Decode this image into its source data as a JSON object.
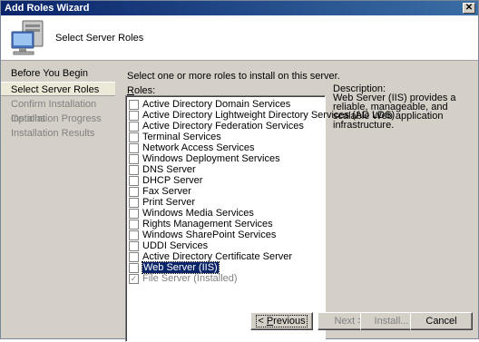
{
  "window": {
    "title": "Add Roles Wizard",
    "close_glyph": "✕"
  },
  "header": {
    "title": "Select Server Roles",
    "icon": "server-computer-icon"
  },
  "nav": {
    "items": [
      {
        "label": "Before You Begin",
        "state": "done"
      },
      {
        "label": "Select Server Roles",
        "state": "active"
      },
      {
        "label": "Confirm Installation Options",
        "state": "pending"
      },
      {
        "label": "Installation Progress",
        "state": "pending"
      },
      {
        "label": "Installation Results",
        "state": "pending"
      }
    ]
  },
  "content": {
    "instruction": "Select one or more roles to install on this server.",
    "roles_label_mnemonic": "R",
    "roles_label_rest": "oles:",
    "roles": [
      {
        "label": "Active Directory Domain Services",
        "checked": false
      },
      {
        "label": "Active Directory Lightweight Directory Services (AD LDS)",
        "checked": false
      },
      {
        "label": "Active Directory Federation Services",
        "checked": false
      },
      {
        "label": "Terminal Services",
        "checked": false
      },
      {
        "label": "Network Access Services",
        "checked": false
      },
      {
        "label": "Windows Deployment Services",
        "checked": false
      },
      {
        "label": "DNS Server",
        "checked": false
      },
      {
        "label": "DHCP Server",
        "checked": false
      },
      {
        "label": "Fax Server",
        "checked": false
      },
      {
        "label": "Print Server",
        "checked": false
      },
      {
        "label": "Windows Media Services",
        "checked": false
      },
      {
        "label": "Rights Management Services",
        "checked": false
      },
      {
        "label": "Windows SharePoint Services",
        "checked": false
      },
      {
        "label": "UDDI Services",
        "checked": false
      },
      {
        "label": "Active Directory Certificate Server",
        "checked": false
      },
      {
        "label": "Web Server (IIS)",
        "checked": false,
        "selected": true
      },
      {
        "label": "File Server  (Installed)",
        "checked": true,
        "disabled": true
      }
    ],
    "description_heading": "Description:",
    "description_body": "Web Server (IIS) provides a reliable, manageable, and scalable Web application infrastructure."
  },
  "buttons": {
    "previous": {
      "mnemonic": "P",
      "rest": "revious",
      "prefix": "< "
    },
    "next": "Next >",
    "install": "Install...",
    "cancel": "Cancel"
  },
  "colors": {
    "title_start": "#0a246a",
    "title_end": "#3a6ea5",
    "selection": "#0a246a"
  }
}
